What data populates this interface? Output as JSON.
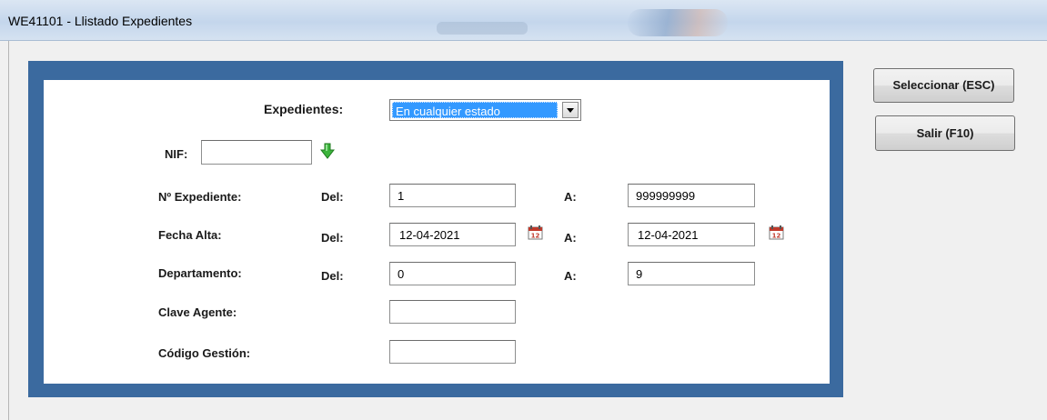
{
  "window": {
    "title": "WE41101 - Llistado Expedientes"
  },
  "form": {
    "expedientes": {
      "label": "Expedientes:",
      "value": "En cualquier estado"
    },
    "nif": {
      "label": "NIF:",
      "value": ""
    },
    "numero_expediente": {
      "label": "Nº Expediente:",
      "del_label": "Del:",
      "del_value": "1",
      "a_label": "A:",
      "a_value": "999999999"
    },
    "fecha_alta": {
      "label": "Fecha Alta:",
      "del_label": "Del:",
      "del_value": "12-04-2021",
      "a_label": "A:",
      "a_value": "12-04-2021"
    },
    "departamento": {
      "label": "Departamento:",
      "del_label": "Del:",
      "del_value": "0",
      "a_label": "A:",
      "a_value": "9"
    },
    "clave_agente": {
      "label": "Clave Agente:",
      "value": ""
    },
    "codigo_gestion": {
      "label": "Código Gestión:",
      "value": ""
    }
  },
  "buttons": {
    "seleccionar": "Seleccionar (ESC)",
    "salir": "Salir (F10)"
  },
  "icons": {
    "nif_lookup": "green-down-arrow-icon",
    "calendar": "calendar-icon"
  },
  "colors": {
    "frame": "#3b6a9f",
    "selection": "#3399ff",
    "arrow": "#2e9e2e"
  }
}
